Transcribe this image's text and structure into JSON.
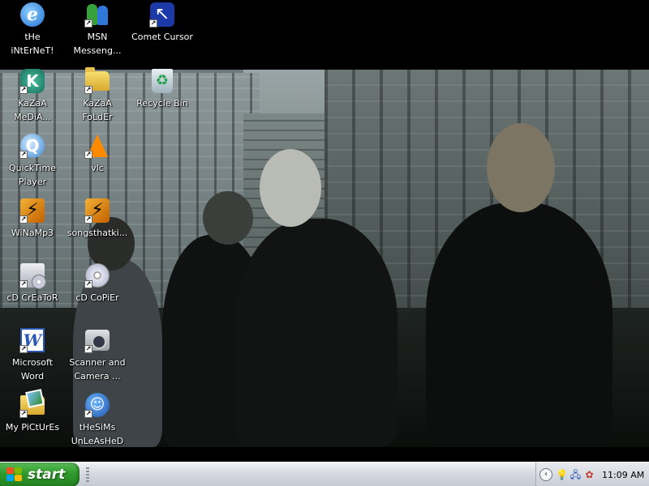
{
  "desktop": {
    "icons": [
      {
        "id": "internet",
        "label_lines": [
          "tHe",
          "iNtErNeT!"
        ],
        "icon": "internet-explorer-icon"
      },
      {
        "id": "msn",
        "label_lines": [
          "MSN",
          "Messeng..."
        ],
        "icon": "msn-messenger-icon"
      },
      {
        "id": "comet",
        "label_lines": [
          "Comet Cursor"
        ],
        "icon": "comet-cursor-icon"
      },
      {
        "id": "kazaa-media",
        "label_lines": [
          "KaZaA",
          "MeDiA..."
        ],
        "icon": "kazaa-icon"
      },
      {
        "id": "kazaa-folder",
        "label_lines": [
          "KaZaA",
          "FoLdEr"
        ],
        "icon": "folder-icon"
      },
      {
        "id": "recycle-bin",
        "label_lines": [
          "Recycle Bin"
        ],
        "icon": "recycle-bin-icon"
      },
      {
        "id": "quicktime",
        "label_lines": [
          "QuickTime",
          "Player"
        ],
        "icon": "quicktime-icon"
      },
      {
        "id": "vlc",
        "label_lines": [
          "vlc"
        ],
        "icon": "vlc-cone-icon"
      },
      {
        "id": "winamp",
        "label_lines": [
          "WiNaMp3"
        ],
        "icon": "winamp-icon"
      },
      {
        "id": "songs",
        "label_lines": [
          "songsthatki..."
        ],
        "icon": "winamp-playlist-icon"
      },
      {
        "id": "cd-creator",
        "label_lines": [
          "cD CrEaToR"
        ],
        "icon": "cd-creator-icon"
      },
      {
        "id": "cd-copier",
        "label_lines": [
          "cD CoPiEr"
        ],
        "icon": "cd-disc-icon"
      },
      {
        "id": "word",
        "label_lines": [
          "Microsoft",
          "Word"
        ],
        "icon": "word-icon"
      },
      {
        "id": "scanner",
        "label_lines": [
          "Scanner and",
          "Camera ..."
        ],
        "icon": "scanner-camera-icon"
      },
      {
        "id": "pictures",
        "label_lines": [
          "My PiCtUrEs"
        ],
        "icon": "pictures-folder-icon"
      },
      {
        "id": "sims",
        "label_lines": [
          "tHeSiMs",
          "UnLeAsHeD"
        ],
        "icon": "sims-icon"
      }
    ]
  },
  "taskbar": {
    "start_label": "start",
    "tray": {
      "icons": [
        "chevron-left-icon",
        "lightbulb-icon",
        "network-icon",
        "messenger-tray-icon"
      ],
      "clock": "11:09 AM"
    }
  }
}
